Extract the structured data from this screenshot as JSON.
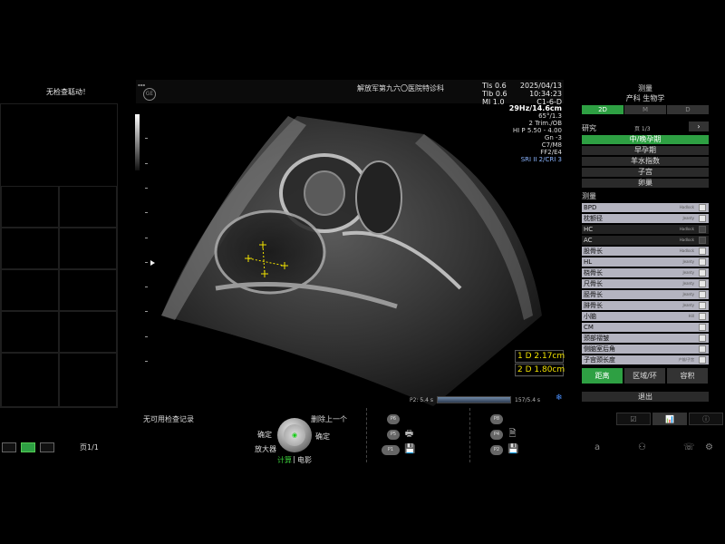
{
  "left_panel": {
    "title": "无检查聒动！",
    "view_buttons": [
      "single-view",
      "dual-view",
      "quad-view"
    ],
    "pager": "页1/1"
  },
  "header": {
    "hospital": "解放军第九六〇医院特诊科",
    "tis": "TIs 0.6",
    "tib": "TIb 0.6",
    "mi": "MI 1.0",
    "date": "2025/04/13",
    "time": "10:34:23",
    "probe": "C1-6-D",
    "logo_text": "GE"
  },
  "params": [
    "29Hz/14.6cm",
    "65°/1.3",
    "2 Trim./OB",
    "HI P 5.50 - 4.00",
    "Gn -3",
    "C7/M8",
    "FF2/E4",
    "SRI II 2/CRI 3"
  ],
  "results": [
    "1 D 2.17cm",
    "2 D 1.80cm"
  ],
  "cine": {
    "left": "P2: 5.4 s",
    "right": "157/5.4 s"
  },
  "bottom": {
    "no_history": "无可用检查记录",
    "confirm_left": "确定",
    "delete_prev": "删除上一个",
    "confirm_right": "确定",
    "magnifier": "放大器",
    "calc": "计算",
    "sep": "|",
    "cine": "电影",
    "p_buttons_left": [
      "P6",
      "P5",
      "P1"
    ],
    "p_buttons_right": [
      "P8",
      "P4",
      "P2"
    ]
  },
  "right_panel": {
    "title": "测量",
    "subtitle": "产科 生物学",
    "modes": [
      "2D",
      "M",
      "D"
    ],
    "study_label": "研究",
    "page_indicator": "页 1/3",
    "next": "›",
    "studies": [
      "中/晚孕期",
      "早孕期",
      "羊水指数",
      "子宫",
      "卵巢"
    ],
    "measure_heading": "测量",
    "measures": [
      {
        "label": "BPD",
        "tag": "Hadlock"
      },
      {
        "label": "枕额径",
        "tag": "Jeanty"
      },
      {
        "label": "HC",
        "tag": "Hadlock"
      },
      {
        "label": "AC",
        "tag": "Hadlock"
      },
      {
        "label": "股骨长",
        "tag": "Hadlock"
      },
      {
        "label": "HL",
        "tag": "Jeanty"
      },
      {
        "label": "桡骨长",
        "tag": "Jeanty"
      },
      {
        "label": "尺骨长",
        "tag": "Jeanty"
      },
      {
        "label": "胫骨长",
        "tag": "Jeanty"
      },
      {
        "label": "腓骨长",
        "tag": "Jeanty"
      },
      {
        "label": "小脑",
        "tag": "Hill"
      },
      {
        "label": "CM",
        "tag": ""
      },
      {
        "label": "颈部褶皱",
        "tag": ""
      },
      {
        "label": "侧脑室后角",
        "tag": ""
      },
      {
        "label": "子宫颈长度",
        "tag": "产前/子宫"
      }
    ],
    "tools": [
      "距离",
      "区域/环",
      "容积"
    ],
    "exit": "退出"
  }
}
